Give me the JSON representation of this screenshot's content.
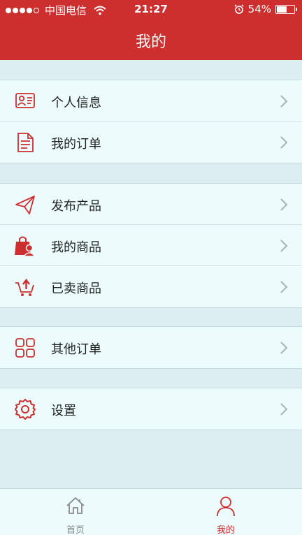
{
  "status_bar": {
    "carrier": "中国电信",
    "time": "21:27",
    "battery_percent": "54%",
    "battery_level": 0.54,
    "signal_bars": 4
  },
  "header": {
    "title": "我的"
  },
  "menu": {
    "personal_info": "个人信息",
    "my_orders": "我的订单",
    "publish_product": "发布产品",
    "my_products": "我的商品",
    "sold_products": "已卖商品",
    "other_orders": "其他订单",
    "settings": "设置"
  },
  "tabbar": {
    "home": "首页",
    "mine": "我的"
  },
  "colors": {
    "accent": "#cd2f2f",
    "background": "#ddeef3",
    "row_background": "#ecfcfc",
    "inactive_tab": "#8a8a8a"
  }
}
